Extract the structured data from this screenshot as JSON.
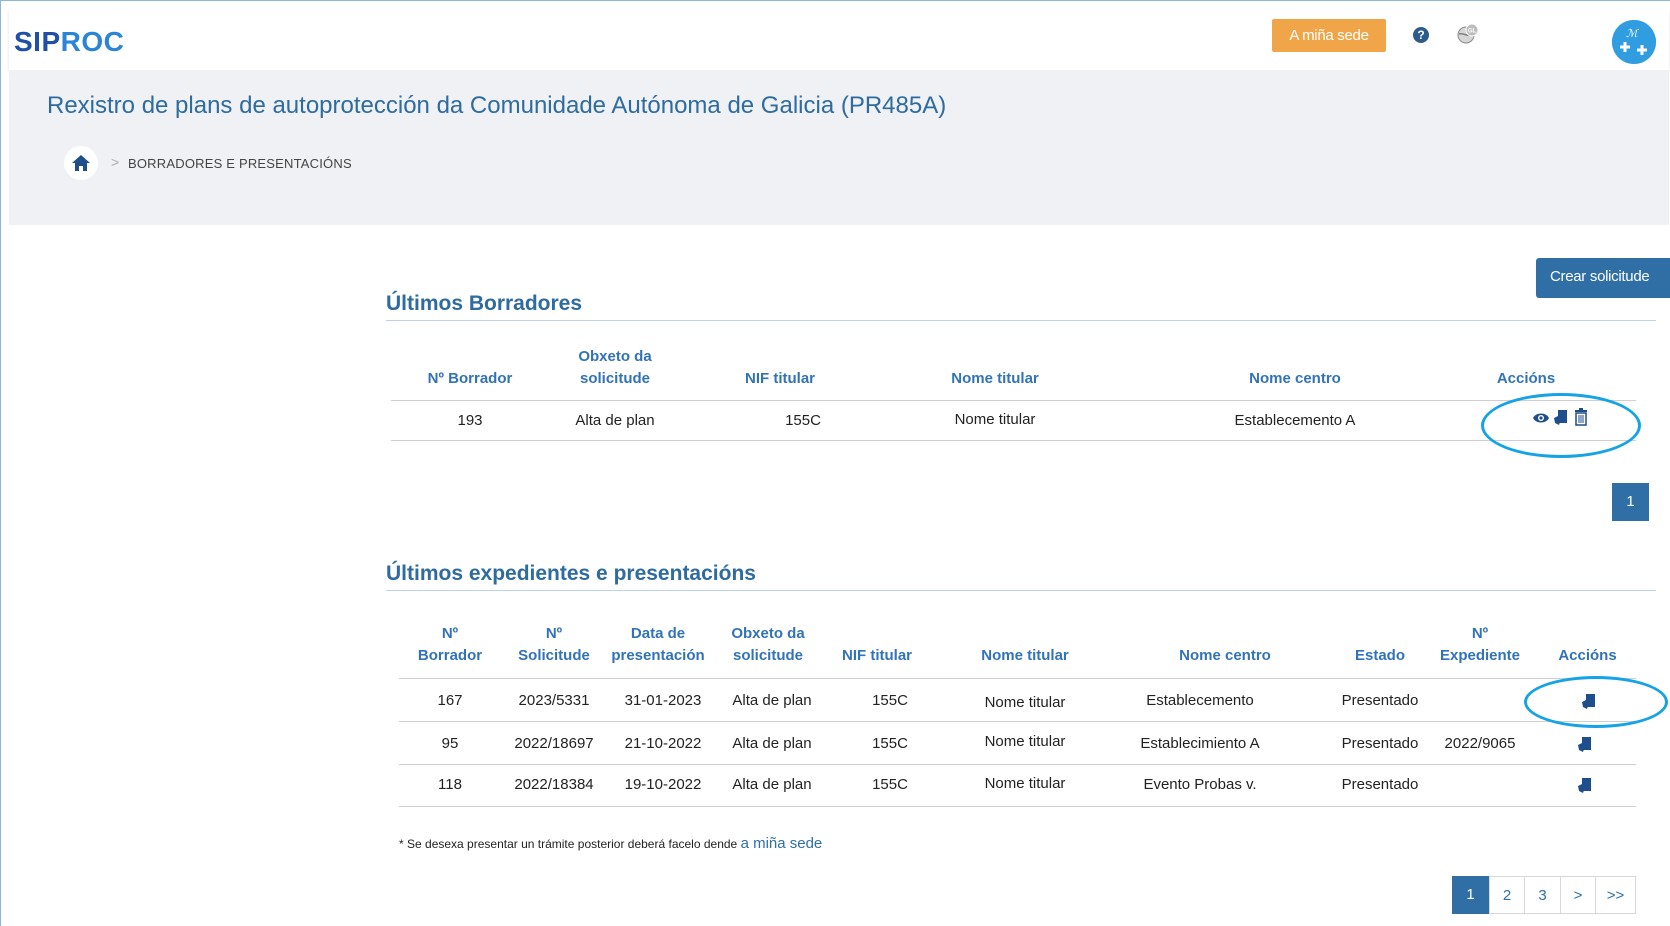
{
  "header": {
    "logo_part1": "SIP",
    "logo_part2": "ROC",
    "sede_button": "A miña sede",
    "help_symbol": "?",
    "icons": [
      "help-icon",
      "language-globe-icon",
      "user-avatar-icon"
    ],
    "avatar_text": "ℳ"
  },
  "page": {
    "title": "Rexistro de plans de autoprotección da Comunidade Autónoma de Galicia (PR485A)",
    "breadcrumb_sep": ">",
    "breadcrumb": "BORRADORES E PRESENTACIÓNS",
    "create_button": "Crear solicitude"
  },
  "drafts": {
    "title": "Últimos Borradores",
    "headers": {
      "borrador": "Nº Borrador",
      "obxeto_1": "Obxeto da",
      "obxeto_2": "solicitude",
      "nif": "NIF titular",
      "nome": "Nome titular",
      "centro": "Nome centro",
      "accions": "Accións"
    },
    "rows": [
      {
        "borrador": "193",
        "obxeto": "Alta de plan",
        "nif": "155C",
        "nome": "Nome titular",
        "centro": "Establecemento  A"
      }
    ],
    "pager": [
      "1"
    ]
  },
  "files": {
    "title": "Últimos expedientes e presentacións",
    "headers": {
      "borrador_1": "Nº",
      "borrador_2": "Borrador",
      "solicitude_1": "Nº",
      "solicitude_2": "Solicitude",
      "data_1": "Data de",
      "data_2": "presentación",
      "obxeto_1": "Obxeto da",
      "obxeto_2": "solicitude",
      "nif": "NIF titular",
      "nome": "Nome titular",
      "centro": "Nome centro",
      "estado": "Estado",
      "expediente_1": "Nº",
      "expediente_2": "Expediente",
      "accions": "Accións"
    },
    "rows": [
      {
        "borrador": "167",
        "solicitude": "2023/5331",
        "data": "31-01-2023",
        "obxeto": "Alta de plan",
        "nif": "155C",
        "nome": "Nome titular",
        "centro": "Establecemento",
        "estado": "Presentado",
        "expediente": ""
      },
      {
        "borrador": "95",
        "solicitude": "2022/18697",
        "data": "21-10-2022",
        "obxeto": "Alta de plan",
        "nif": "155C",
        "nome": "Nome titular",
        "centro": "Establecimiento  A",
        "estado": "Presentado",
        "expediente": "2022/9065"
      },
      {
        "borrador": "118",
        "solicitude": "2022/18384",
        "data": "19-10-2022",
        "obxeto": "Alta de plan",
        "nif": "155C",
        "nome": "Nome titular",
        "centro": "Evento Probas v.",
        "estado": "Presentado",
        "expediente": ""
      }
    ],
    "note": "* Se desexa presentar un trámite posterior deberá facelo dende",
    "note_link": "a miña sede",
    "pager": [
      "1",
      "2",
      "3",
      ">",
      ">>"
    ]
  },
  "colors": {
    "brand_blue": "#2f6fa6",
    "title_blue": "#2e6b9e",
    "accent_orange": "#f0a648",
    "highlight_oval": "#16a3e6"
  }
}
